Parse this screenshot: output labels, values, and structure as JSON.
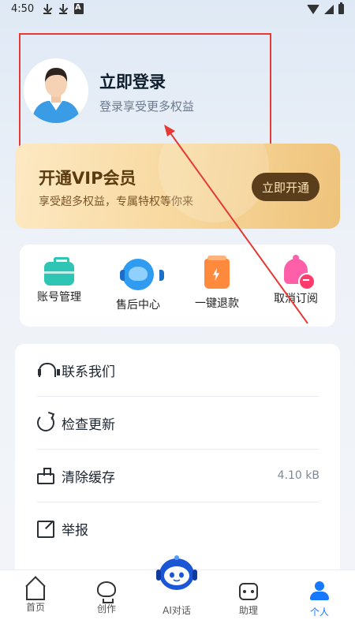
{
  "status_bar": {
    "time": "4:50"
  },
  "profile": {
    "title": "立即登录",
    "subtitle": "登录享受更多权益"
  },
  "vip": {
    "title": "开通VIP会员",
    "subtitle": "享受超多权益，专属特权等你来",
    "button": "立即开通"
  },
  "quick_actions": [
    {
      "label": "账号管理",
      "icon": "briefcase-icon"
    },
    {
      "label": "售后中心",
      "icon": "headset-service-icon"
    },
    {
      "label": "一键退款",
      "icon": "refund-bolt-icon"
    },
    {
      "label": "取消订阅",
      "icon": "bell-minus-icon"
    }
  ],
  "menu": [
    {
      "label": "联系我们",
      "icon": "headset-icon",
      "value": ""
    },
    {
      "label": "检查更新",
      "icon": "refresh-icon",
      "value": ""
    },
    {
      "label": "清除缓存",
      "icon": "broom-icon",
      "value": "4.10 kB"
    },
    {
      "label": "举报",
      "icon": "edit-icon",
      "value": ""
    }
  ],
  "nav": [
    {
      "label": "首页",
      "icon": "home-icon"
    },
    {
      "label": "创作",
      "icon": "bulb-icon"
    },
    {
      "label": "AI对话",
      "icon": "ai-robot-icon"
    },
    {
      "label": "助理",
      "icon": "robot-icon"
    },
    {
      "label": "个人",
      "icon": "person-icon",
      "active": true
    }
  ],
  "colors": {
    "accent": "#1677ff",
    "annotation": "#e53935",
    "vip_button": "#5a3e1b"
  }
}
